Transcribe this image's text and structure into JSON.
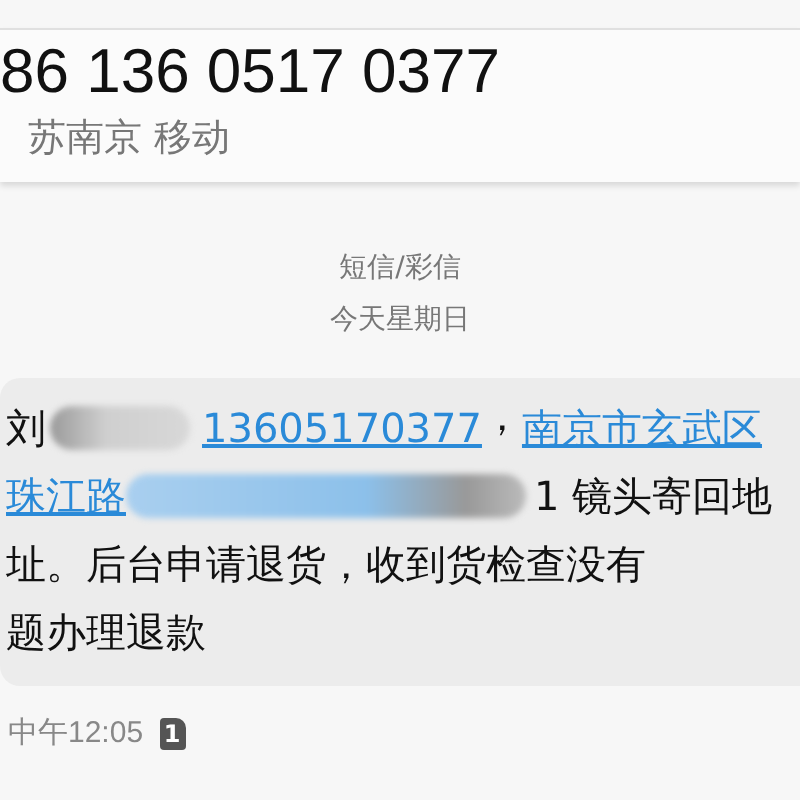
{
  "contact": {
    "number": "86 136 0517 0377",
    "location": "苏南京 移动"
  },
  "thread_info": {
    "channel": "短信/彩信",
    "date": "今天星期日"
  },
  "message": {
    "lines": [
      [
        {
          "kind": "text",
          "text": "刘"
        },
        {
          "kind": "redacted"
        },
        {
          "kind": "link",
          "text": "13605170377"
        },
        {
          "kind": "punct",
          "text": "，"
        },
        {
          "kind": "link",
          "text": "南京市玄武区"
        }
      ],
      [
        {
          "kind": "link",
          "text": "珠江路"
        },
        {
          "kind": "redacted"
        },
        {
          "kind": "text",
          "text": "1 镜头寄回地"
        }
      ],
      [
        {
          "kind": "text",
          "text": "址。后台申请退货，收到货检查没有"
        }
      ],
      [
        {
          "kind": "text",
          "text": "题办理退款"
        }
      ]
    ],
    "time": "中午12:05",
    "sim": "1"
  }
}
